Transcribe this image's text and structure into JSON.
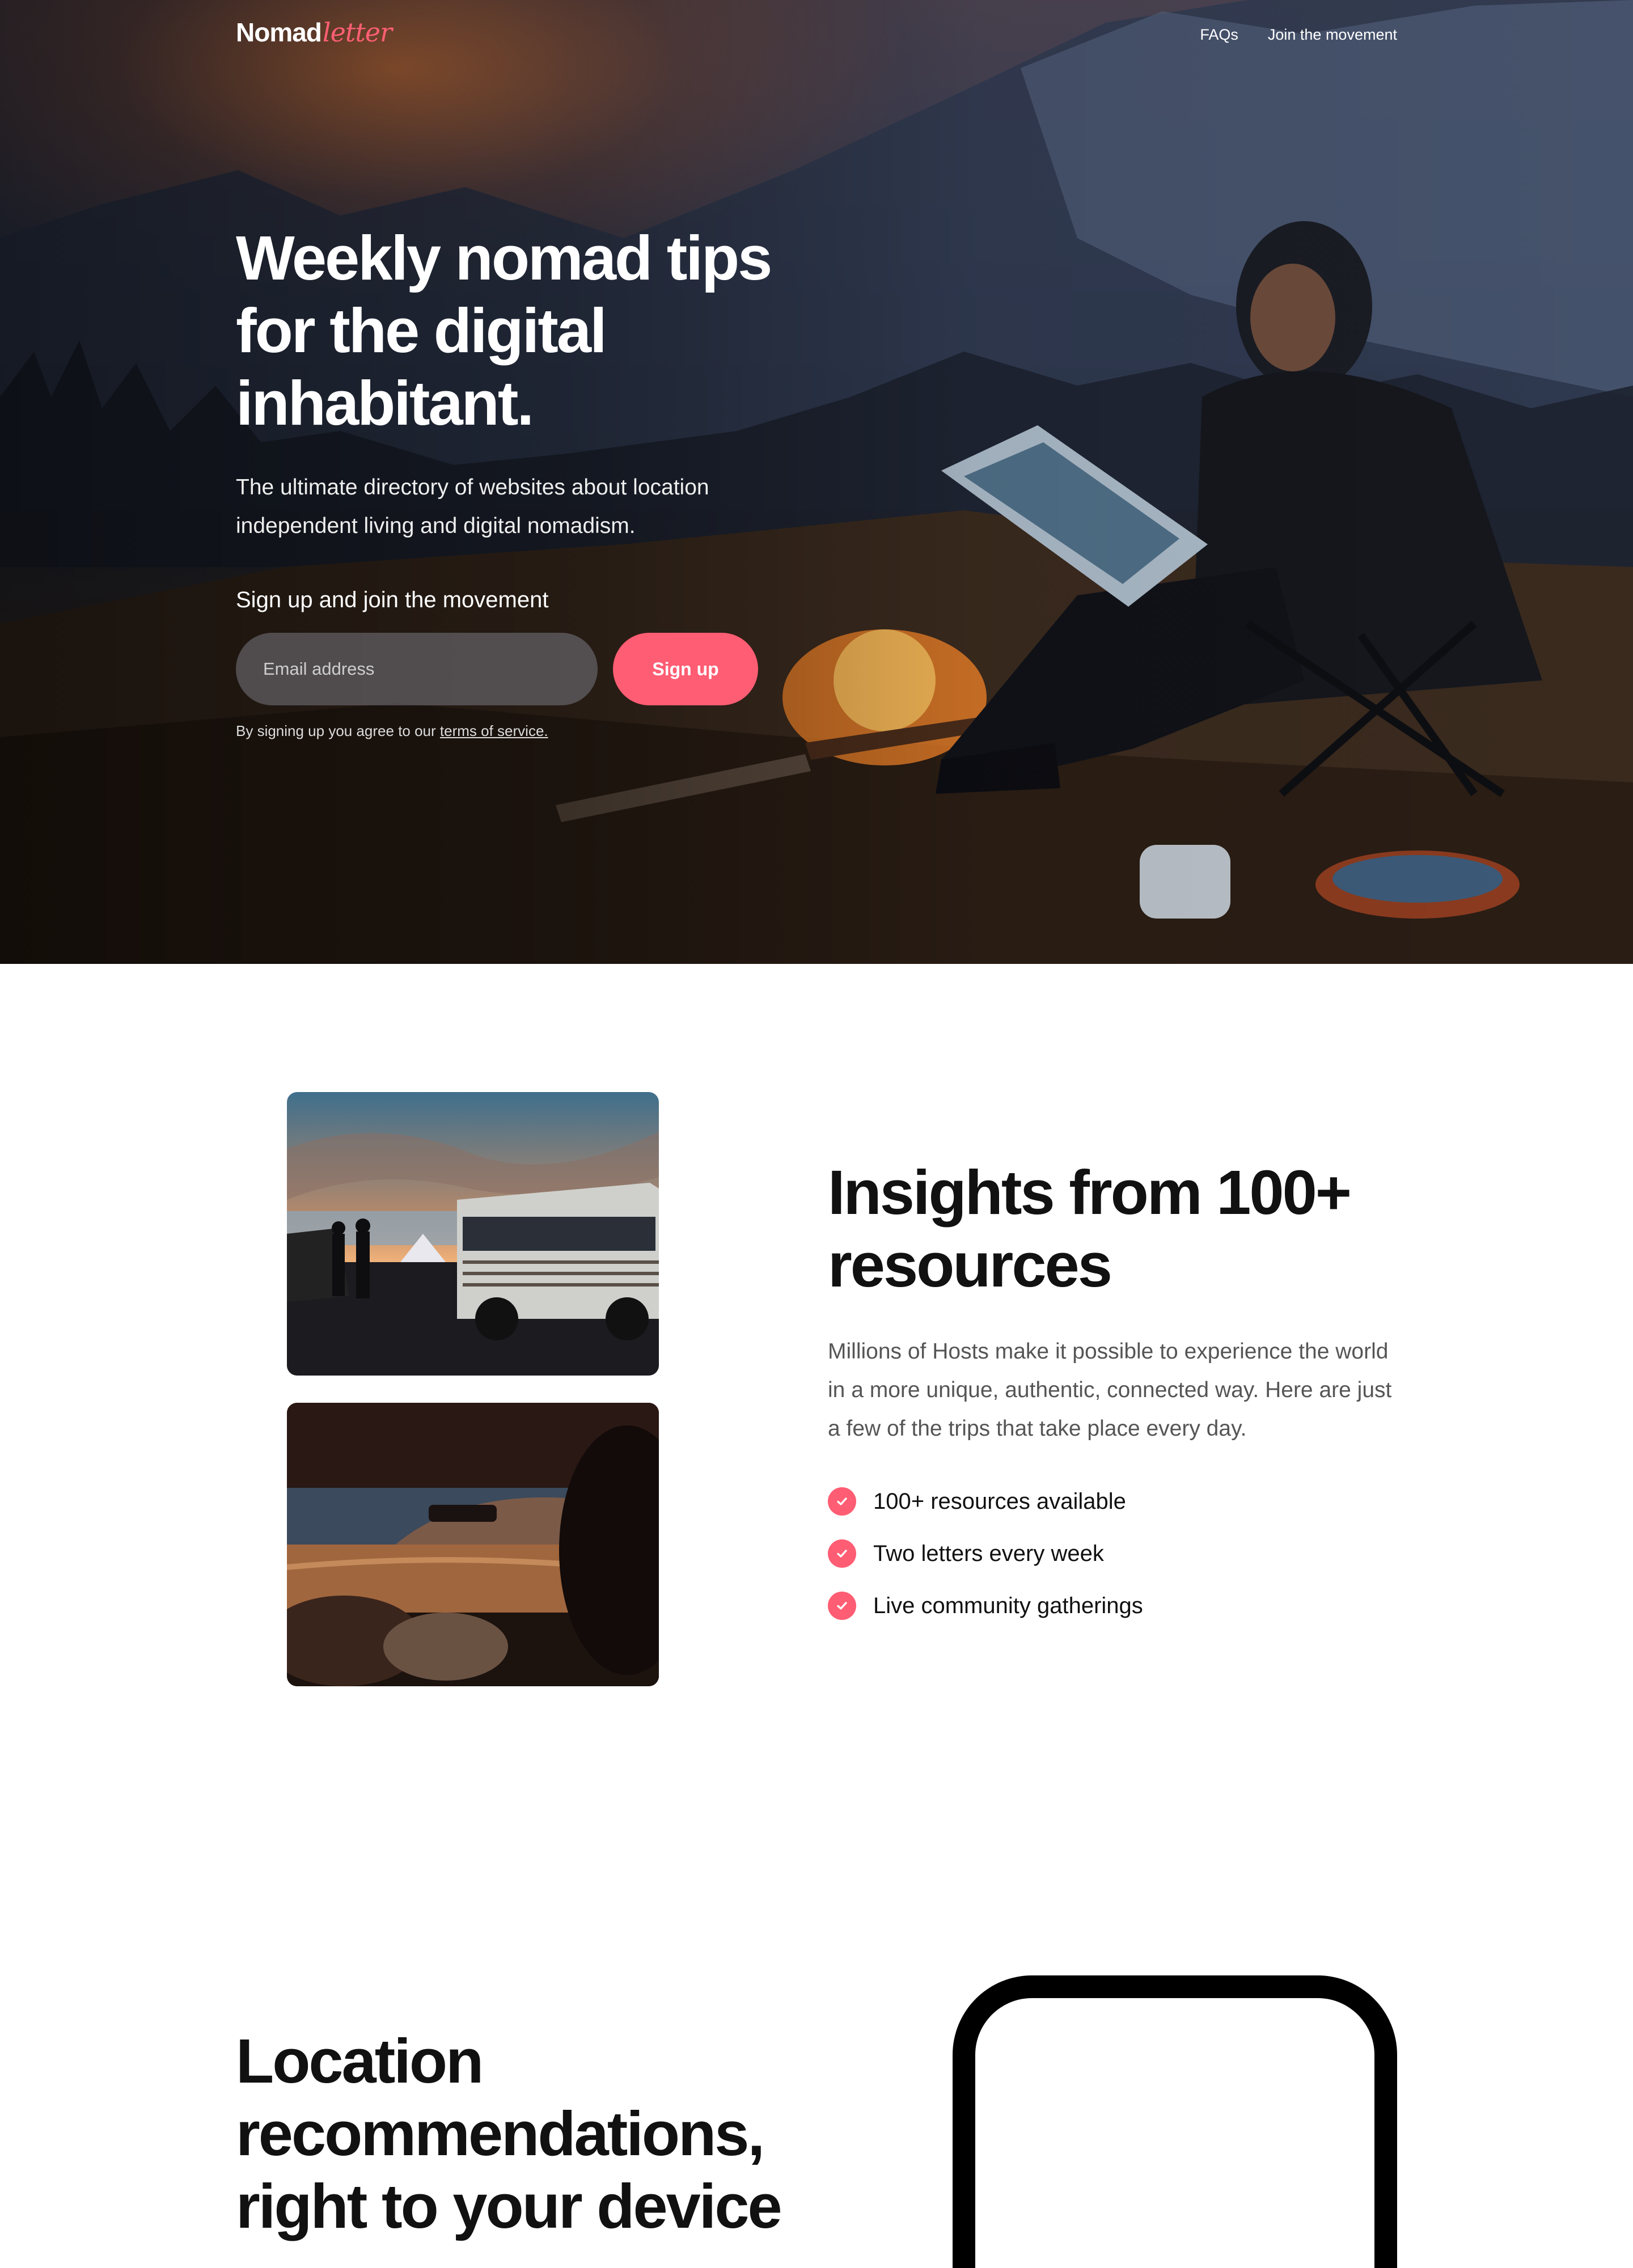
{
  "brand": {
    "name": "Nomad",
    "script": "letter",
    "accent": "#ff5d73"
  },
  "nav": {
    "items": [
      "FAQs",
      "Join the movement"
    ]
  },
  "hero": {
    "title": "Weekly nomad tips for the digital inhabitant.",
    "subtitle": "The ultimate directory of websites about location independent living and digital nomadism.",
    "cta_label": "Sign up and join the movement",
    "email_placeholder": "Email address",
    "signup_label": "Sign up",
    "terms_prefix": "By signing up you agree to our",
    "terms_link": "terms of service."
  },
  "insights": {
    "title": "Insights from 100+ resources",
    "text": "Millions of Hosts make it possible to experience the world in a more unique, authentic, connected way. Here are just a few of the trips that take place every day.",
    "features": [
      "100+ resources available",
      "Two letters every week",
      "Live community gatherings"
    ],
    "check_icon": "check-icon"
  },
  "location": {
    "title": "Location recommendations, right to your device"
  }
}
